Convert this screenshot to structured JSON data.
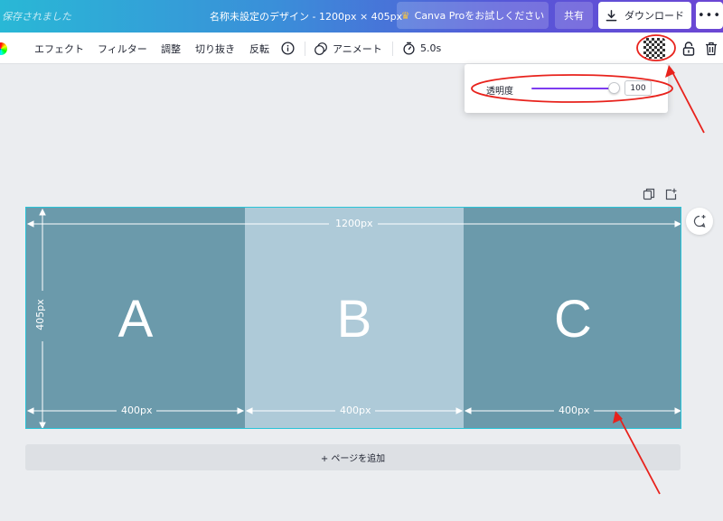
{
  "header": {
    "saved_status": "保存されました",
    "doc_title": "名称未設定のデザイン - 1200px × 405px",
    "pro_button": "Canva Proをお試しください",
    "share_button": "共有",
    "download_button": "ダウンロード",
    "more_button": "•••"
  },
  "toolbar": {
    "effect": "エフェクト",
    "filter": "フィルター",
    "adjust": "調整",
    "crop": "切り抜き",
    "flip": "反転",
    "animate": "アニメート",
    "duration": "5.0s"
  },
  "transparency_popover": {
    "label": "透明度",
    "value": "100",
    "slider_percent": 100
  },
  "design": {
    "width_label": "1200px",
    "height_label": "405px",
    "panels": [
      {
        "letter": "A",
        "width_label": "400px",
        "color": "#6b9aab"
      },
      {
        "letter": "B",
        "width_label": "400px",
        "color": "#aecad8"
      },
      {
        "letter": "C",
        "width_label": "400px",
        "color": "#6b9aab"
      }
    ]
  },
  "add_page": "+ ページを追加",
  "colors": {
    "accent_purple": "#7d3cf0",
    "selection_border": "#29c4d8",
    "annotation_red": "#e8221c"
  }
}
